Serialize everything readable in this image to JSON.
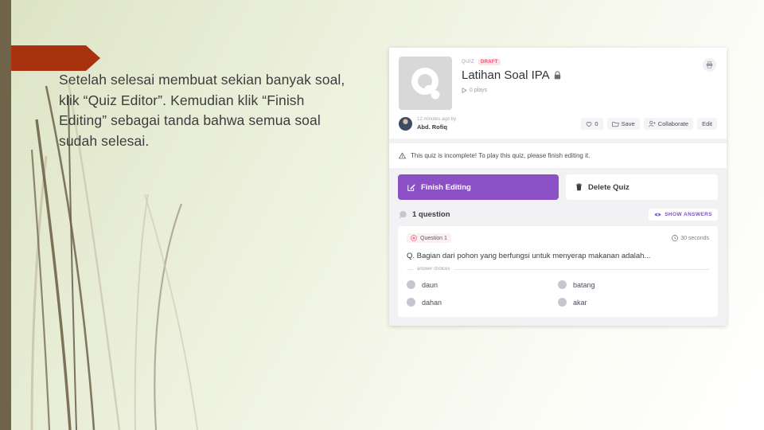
{
  "slide": {
    "body_text": "Setelah selesai membuat sekian banyak soal, klik “Quiz Editor”. Kemudian klik “Finish Editing” sebagai tanda bahwa semua soal sudah selesai.",
    "accent_red": "#a8320e",
    "left_bar_color": "#6f6449",
    "background_start": "#dde3c4",
    "background_end": "#ffffff"
  },
  "quiz": {
    "kicker": "QUIZ",
    "draft_badge": "DRAFT",
    "title": "Latihan Soal IPA",
    "plays": "0 plays",
    "author_time": "12 minutes ago by",
    "author_name": "Abd. Rofiq",
    "like_count": "0",
    "save_label": "Save",
    "collaborate_label": "Collaborate",
    "edit_label": "Edit",
    "warning": "This quiz is incomplete! To play this quiz, please finish editing it.",
    "finish_editing_label": "Finish Editing",
    "delete_quiz_label": "Delete Quiz",
    "question_count_label": "1 question",
    "show_answers_label": "SHOW ANSWERS",
    "primary_color": "#8b4fc6",
    "draft_color": "#ff4d6a",
    "accent_purple": "#7a55c4"
  },
  "question": {
    "number_label": "Question 1",
    "time_label": "30 seconds",
    "text": "Q. Bagian dari pohon yang berfungsi untuk menyerap makanan adalah...",
    "answer_choices_label": "answer choices",
    "choices": [
      {
        "label": "daun"
      },
      {
        "label": "batang"
      },
      {
        "label": "dahan"
      },
      {
        "label": "akar"
      }
    ]
  }
}
